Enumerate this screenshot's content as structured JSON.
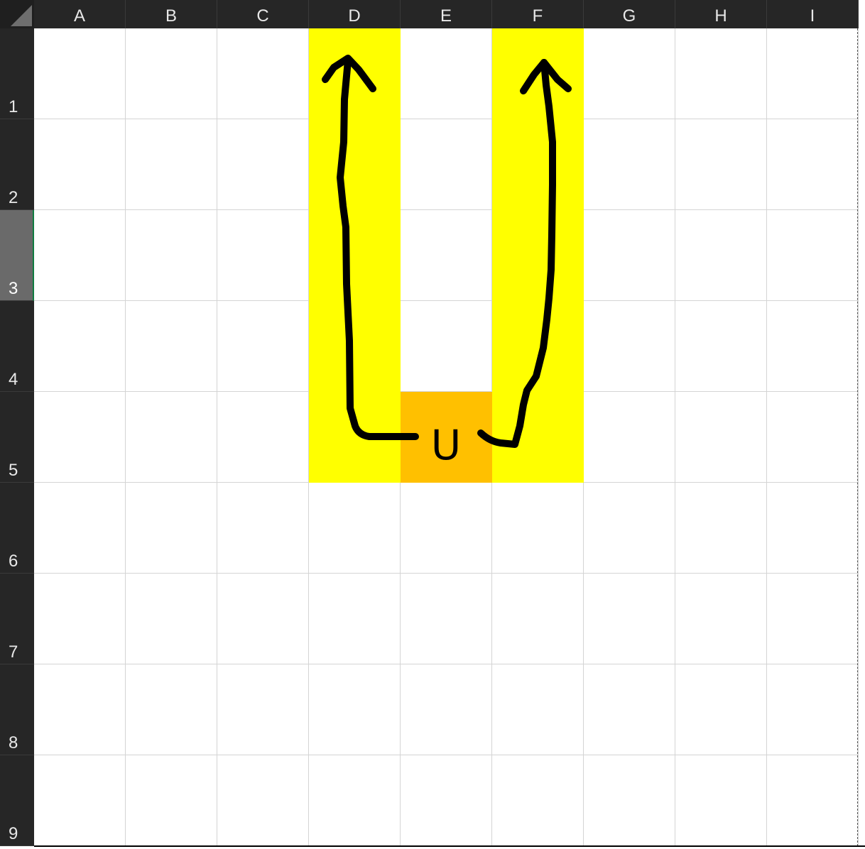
{
  "columns": [
    "A",
    "B",
    "C",
    "D",
    "E",
    "F",
    "G",
    "H",
    "I"
  ],
  "rows": [
    "1",
    "2",
    "3",
    "4",
    "5",
    "6",
    "7",
    "8",
    "9"
  ],
  "selected_row": "3",
  "fills": [
    {
      "column": "D",
      "rows": [
        "1",
        "2",
        "3",
        "4",
        "5"
      ],
      "color": "#ffff00"
    },
    {
      "column": "F",
      "rows": [
        "1",
        "2",
        "3",
        "4",
        "5"
      ],
      "color": "#ffff00"
    },
    {
      "column": "E",
      "rows": [
        "5"
      ],
      "color": "#ffc000"
    }
  ],
  "cells": [
    {
      "ref": "E5",
      "value": "U"
    }
  ],
  "colors": {
    "header_bg": "#262626",
    "header_text": "#e8e8e8",
    "gridline": "#d4d4d4",
    "yellow": "#ffff00",
    "orange": "#ffc000",
    "ink": "#000000"
  },
  "annotation": {
    "description_icon": "hand-drawn-u-arrows-icon"
  }
}
